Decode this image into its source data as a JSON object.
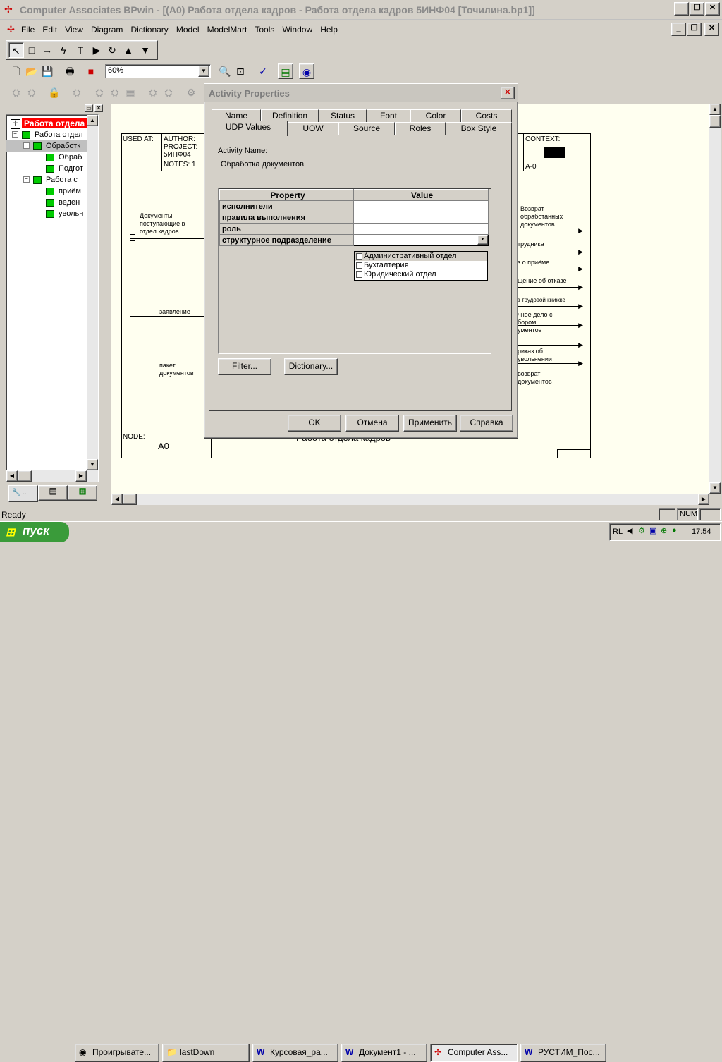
{
  "window": {
    "title": "Computer Associates BPwin - [(A0) Работа отдела кадров - Работа отдела кадров 5ИНФ04  [Точилина.bp1]]"
  },
  "menu": [
    "File",
    "Edit",
    "View",
    "Diagram",
    "Dictionary",
    "Model",
    "ModelMart",
    "Tools",
    "Window",
    "Help"
  ],
  "toolbar": {
    "zoom": "60%"
  },
  "tree": {
    "items": [
      {
        "label": "Работа отдела",
        "level": 0,
        "selected": true
      },
      {
        "label": "Работа отдел",
        "level": 1
      },
      {
        "label": "Обработк",
        "level": 2,
        "selected2": true
      },
      {
        "label": "Обраб",
        "level": 3
      },
      {
        "label": "Подгот",
        "level": 3
      },
      {
        "label": "Работа с",
        "level": 2
      },
      {
        "label": "приём",
        "level": 3
      },
      {
        "label": "веден",
        "level": 3
      },
      {
        "label": "увольн",
        "level": 3
      }
    ],
    "tab_label": ".."
  },
  "diagram": {
    "used_at": "USED AT:",
    "author": "AUTHOR:",
    "project": "PROJECT:",
    "project_val": "5ИНФ04",
    "notes": "NOTES: 1",
    "context": "CONTEXT:",
    "context_node": "A-0",
    "node_label": "NODE:",
    "node_val": "A0",
    "title": "Работа отдела кадров",
    "left_arrows": [
      "Документы поступающие в отдел кадров",
      "заявление",
      "пакет документов"
    ],
    "right_arrows": [
      "Возврат обработанных документов",
      "трудника",
      "з о приёме",
      "щение об отказе",
      "з трудовой книжке",
      "чное дело с бором ументов",
      "риказ об увольнении",
      "возврат документов"
    ]
  },
  "dialog": {
    "title": "Activity Properties",
    "tabs_row1": [
      "Name",
      "Definition",
      "Status",
      "Font",
      "Color",
      "Costs"
    ],
    "tabs_row2": [
      "UDP Values",
      "UOW",
      "Source",
      "Roles",
      "Box Style"
    ],
    "activity_name_label": "Activity Name:",
    "activity_name": "Обработка документов",
    "grid_headers": [
      "Property",
      "Value"
    ],
    "grid_rows": [
      "исполнители",
      "правила выполнения",
      "роль",
      "структурное подразделение"
    ],
    "dropdown_options": [
      "Административный отдел",
      "Бухгалтерия",
      "Юридический отдел"
    ],
    "filter_btn": "Filter...",
    "dictionary_btn": "Dictionary...",
    "ok_btn": "OK",
    "cancel_btn": "Отмена",
    "apply_btn": "Применить",
    "help_btn": "Справка"
  },
  "status": {
    "text": "Ready",
    "num": "NUM"
  },
  "taskbar": {
    "start": "пуск",
    "items": [
      "Проигрывате...",
      "lastDown",
      "Курсовая_ра...",
      "Документ1 - ...",
      "Computer Ass...",
      "РУСТИМ_Пос..."
    ],
    "lang": "RL",
    "clock": "17:54"
  }
}
